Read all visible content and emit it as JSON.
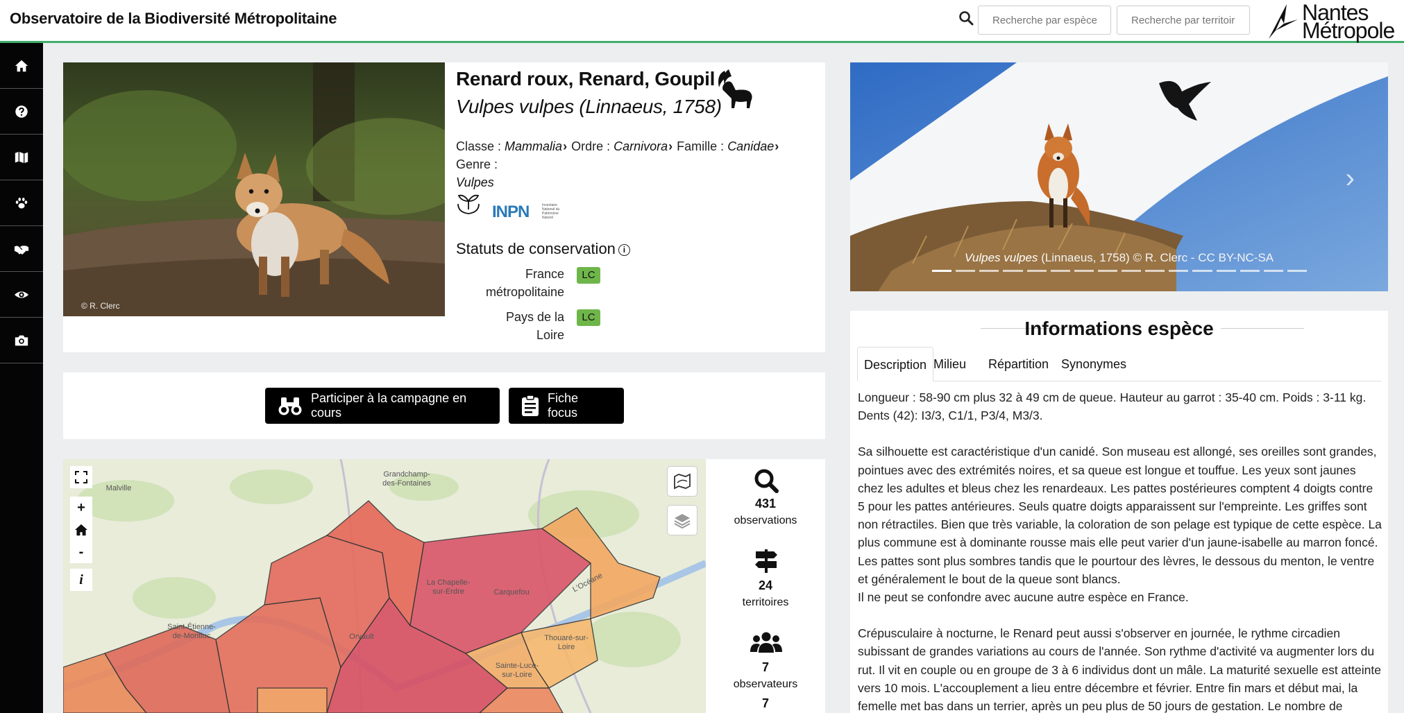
{
  "header": {
    "site_title": "Observatoire de la Biodiversité Métropolitaine",
    "search_species_placeholder": "Recherche par espèce",
    "search_territory_placeholder": "Recherche par territoire",
    "logo_line1": "Nantes",
    "logo_line2": "Métropole",
    "accent_color": "#3fae6b"
  },
  "sidebar": {
    "items": [
      {
        "icon": "home-icon"
      },
      {
        "icon": "question-icon"
      },
      {
        "icon": "map-icon"
      },
      {
        "icon": "paw-icon"
      },
      {
        "icon": "handshake-icon"
      },
      {
        "icon": "eye-icon"
      },
      {
        "icon": "camera-icon"
      }
    ]
  },
  "species": {
    "common_name": "Renard roux, Renard, Goupil",
    "scientific_name": "Vulpes vulpes (Linnaeus, 1758)",
    "photo_credit": "© R. Clerc",
    "taxonomy": {
      "classe_label": "Classe :",
      "classe": "Mammalia",
      "ordre_label": "Ordre :",
      "ordre": "Carnivora",
      "famille_label": "Famille :",
      "famille": "Canidae",
      "genre_label": "Genre :",
      "genre": "Vulpes"
    },
    "inpn_logo_text": "INPN",
    "inpn_caption": "Inventaire National du Patrimoine Naturel",
    "conservation_title": "Statuts de conservation",
    "statuses": [
      {
        "region_line1": "France",
        "region_line2": "métropolitaine",
        "code": "LC"
      },
      {
        "region_line1": "Pays de la Loire",
        "code": "LC"
      }
    ],
    "lc_color": "#6fb64a"
  },
  "actions": {
    "participate_label": "Participer à la campagne en cours",
    "focus_label": "Fiche focus"
  },
  "map": {
    "labels": [
      "Grandchamp-des-Fontaines",
      "Saint-Étienne-de-Montluc",
      "La Chapelle-sur-Erdre",
      "Carquefou",
      "Orvault",
      "Thouaré-sur-Loire",
      "Sainte-Luce-sur-Loire",
      "L'Océane",
      "Malville"
    ],
    "zoom_in": "+",
    "zoom_out": "-",
    "info": "i"
  },
  "stats": [
    {
      "icon": "search-icon",
      "value": "431",
      "label": "observations"
    },
    {
      "icon": "signpost-icon",
      "value": "24",
      "label": "territoires"
    },
    {
      "icon": "users-icon",
      "value": "7",
      "label": "observateurs"
    },
    {
      "value": "7"
    }
  ],
  "carousel": {
    "caption_sci": "Vulpes vulpes",
    "caption_rest": " (Linnaeus, 1758) © R. Clerc - CC BY-NC-SA",
    "slide_count": 16,
    "active_slide": 1
  },
  "info": {
    "title": "Informations espèce",
    "tabs": [
      "Description",
      "Milieu",
      "Répartition",
      "Synonymes"
    ],
    "active_tab": "Description",
    "paragraphs": [
      "Longueur : 58-90 cm plus 32 à 49 cm de queue. Hauteur au garrot : 35-40 cm. Poids : 3-11 kg. Dents (42): I3/3, C1/1, P3/4, M3/3.",
      "Sa silhouette est caractéristique d'un canidé. Son museau est allongé, ses oreilles sont grandes, pointues avec des extrémités noires, et sa queue est longue et touffue. Les yeux sont jaunes chez les adultes et bleus chez les renardeaux. Les pattes postérieures comptent 4 doigts contre 5 pour les pattes antérieures. Seuls quatre doigts apparaissent sur l'empreinte. Les griffes sont non rétractiles. Bien que très variable, la coloration de son pelage est typique de cette espèce. La plus commune est à dominante rousse mais elle peut varier d'un jaune-isabelle au marron foncé. Les pattes sont plus sombres tandis que le pourtour des lèvres, le dessous du menton, le ventre et généralement le bout de la queue sont blancs.",
      "Il ne peut se confondre avec aucune autre espèce en France.",
      "Crépusculaire à nocturne, le Renard peut aussi s'observer en journée, le rythme circadien subissant de grandes variations au cours de l'année. Son rythme d'activité va augmenter lors du rut. Il vit en couple ou en groupe de 3 à 6 individus dont un mâle. La maturité sexuelle est atteinte vers 10 mois. L'accouplement a lieu entre décembre et février. Entre fin mars et début mai, la femelle met bas dans un terrier, après un peu plus de 50 jours de gestation. Le nombre de"
    ]
  }
}
